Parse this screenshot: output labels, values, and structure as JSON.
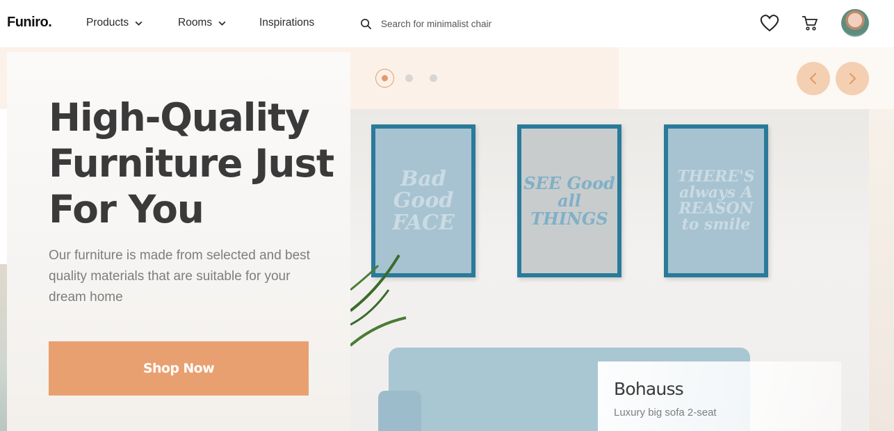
{
  "header": {
    "logo": "Funiro.",
    "nav": [
      {
        "label": "Products",
        "has_dropdown": true
      },
      {
        "label": "Rooms",
        "has_dropdown": true
      },
      {
        "label": "Inspirations",
        "has_dropdown": false
      }
    ],
    "search": {
      "placeholder": "Search for minimalist chair",
      "value": "",
      "icon": "search-icon"
    },
    "icons": [
      "heart-icon",
      "cart-icon"
    ],
    "avatar": "user-avatar"
  },
  "hero": {
    "title": "High-Quality Furniture Just For You",
    "description": "Our furniture is made from selected and best quality materials that are suitable for your dream home",
    "cta_label": "Shop Now"
  },
  "carousel": {
    "slide_count": 3,
    "active_index": 0,
    "prev_icon": "chevron-left-icon",
    "next_icon": "chevron-right-icon"
  },
  "frames": [
    {
      "text": "Bad Good FACE"
    },
    {
      "text": "SEE Good all THINGS"
    },
    {
      "text": "THERE'S always A REASON to smile"
    }
  ],
  "product": {
    "name": "Bohauss",
    "subtitle": "Luxury big sofa 2-seat"
  },
  "colors": {
    "accent": "#E9A070",
    "accent_light": "#F5CFB2",
    "text_dark": "#3A3A3A",
    "text_muted": "#7D7D7D",
    "peach_bg": "#FBF1E8"
  }
}
